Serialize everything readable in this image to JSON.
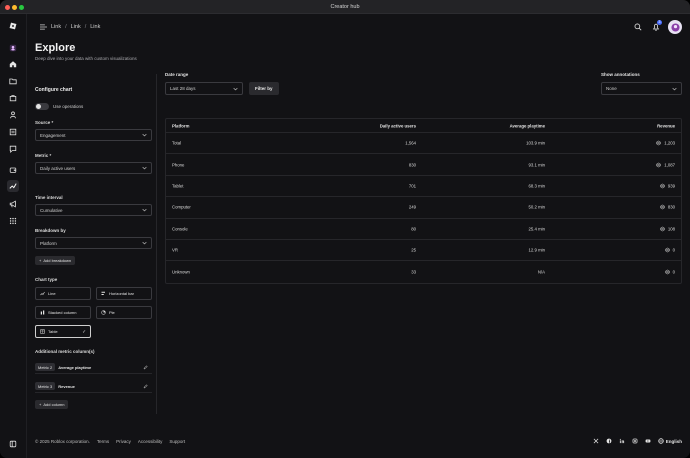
{
  "window": {
    "title": "Creator hub"
  },
  "breadcrumbs": [
    "Link",
    "Link",
    "Link"
  ],
  "header": {
    "notification_count": "3"
  },
  "page": {
    "title": "Explore",
    "subtitle": "Deep dive into your data with custom visualizations"
  },
  "config": {
    "heading": "Configure chart",
    "use_operations_label": "Use operations",
    "source_label": "Source *",
    "source_value": "Engagement",
    "metric_label": "Metric *",
    "metric_value": "Daily active users",
    "time_interval_label": "Time interval",
    "time_interval_value": "Cumulative",
    "breakdown_label": "Breakdown by",
    "breakdown_value": "Platform",
    "add_breakdown_label": "Add breakdown",
    "chart_type_label": "Chart type",
    "chart_types": [
      "Line",
      "Horizontal bar",
      "Stacked column",
      "Pie",
      "Table"
    ],
    "selected_chart_type": "Table",
    "additional_label": "Additional metric column(s)",
    "metrics": [
      {
        "tag": "Metric 2",
        "name": "Average playtime"
      },
      {
        "tag": "Metric 3",
        "name": "Revenue"
      }
    ],
    "add_column_label": "Add column"
  },
  "controls": {
    "date_range_label": "Date range",
    "date_range_value": "Last 28 days",
    "filter_button": "Filter by",
    "annotations_label": "Show annotations",
    "annotations_value": "None"
  },
  "table": {
    "headers": [
      "Platform",
      "Daily active users",
      "Average playtime",
      "Revenue"
    ],
    "rows": [
      [
        "Total",
        "1,564",
        "103.9 min",
        "1,203"
      ],
      [
        "Phone",
        "830",
        "93.1 min",
        "1,087"
      ],
      [
        "Tablet",
        "701",
        "68.3 min",
        "939"
      ],
      [
        "Computer",
        "249",
        "50.2 min",
        "830"
      ],
      [
        "Console",
        "80",
        "25.4 min",
        "108"
      ],
      [
        "VR",
        "25",
        "12.9 min",
        "0"
      ],
      [
        "Unknown",
        "33",
        "N/A",
        "0"
      ]
    ]
  },
  "footer": {
    "copyright": "© 2025 Roblox corporation.",
    "links": [
      "Terms",
      "Privacy",
      "Accessibility",
      "Support"
    ],
    "language": "English"
  },
  "icons": {
    "rail": [
      "roblox-logo-icon",
      "avatar-icon",
      "home-icon",
      "folder-icon",
      "store-icon",
      "person-icon",
      "list-icon",
      "chat-icon",
      "wallet-icon",
      "analytics-icon",
      "megaphone-icon",
      "apps-grid-icon"
    ],
    "social": [
      "x-icon",
      "facebook-icon",
      "linkedin-icon",
      "instagram-icon",
      "youtube-icon"
    ]
  },
  "colors": {
    "accent": "#4c6fff",
    "background": "#121215",
    "border": "#3a3a3f"
  }
}
